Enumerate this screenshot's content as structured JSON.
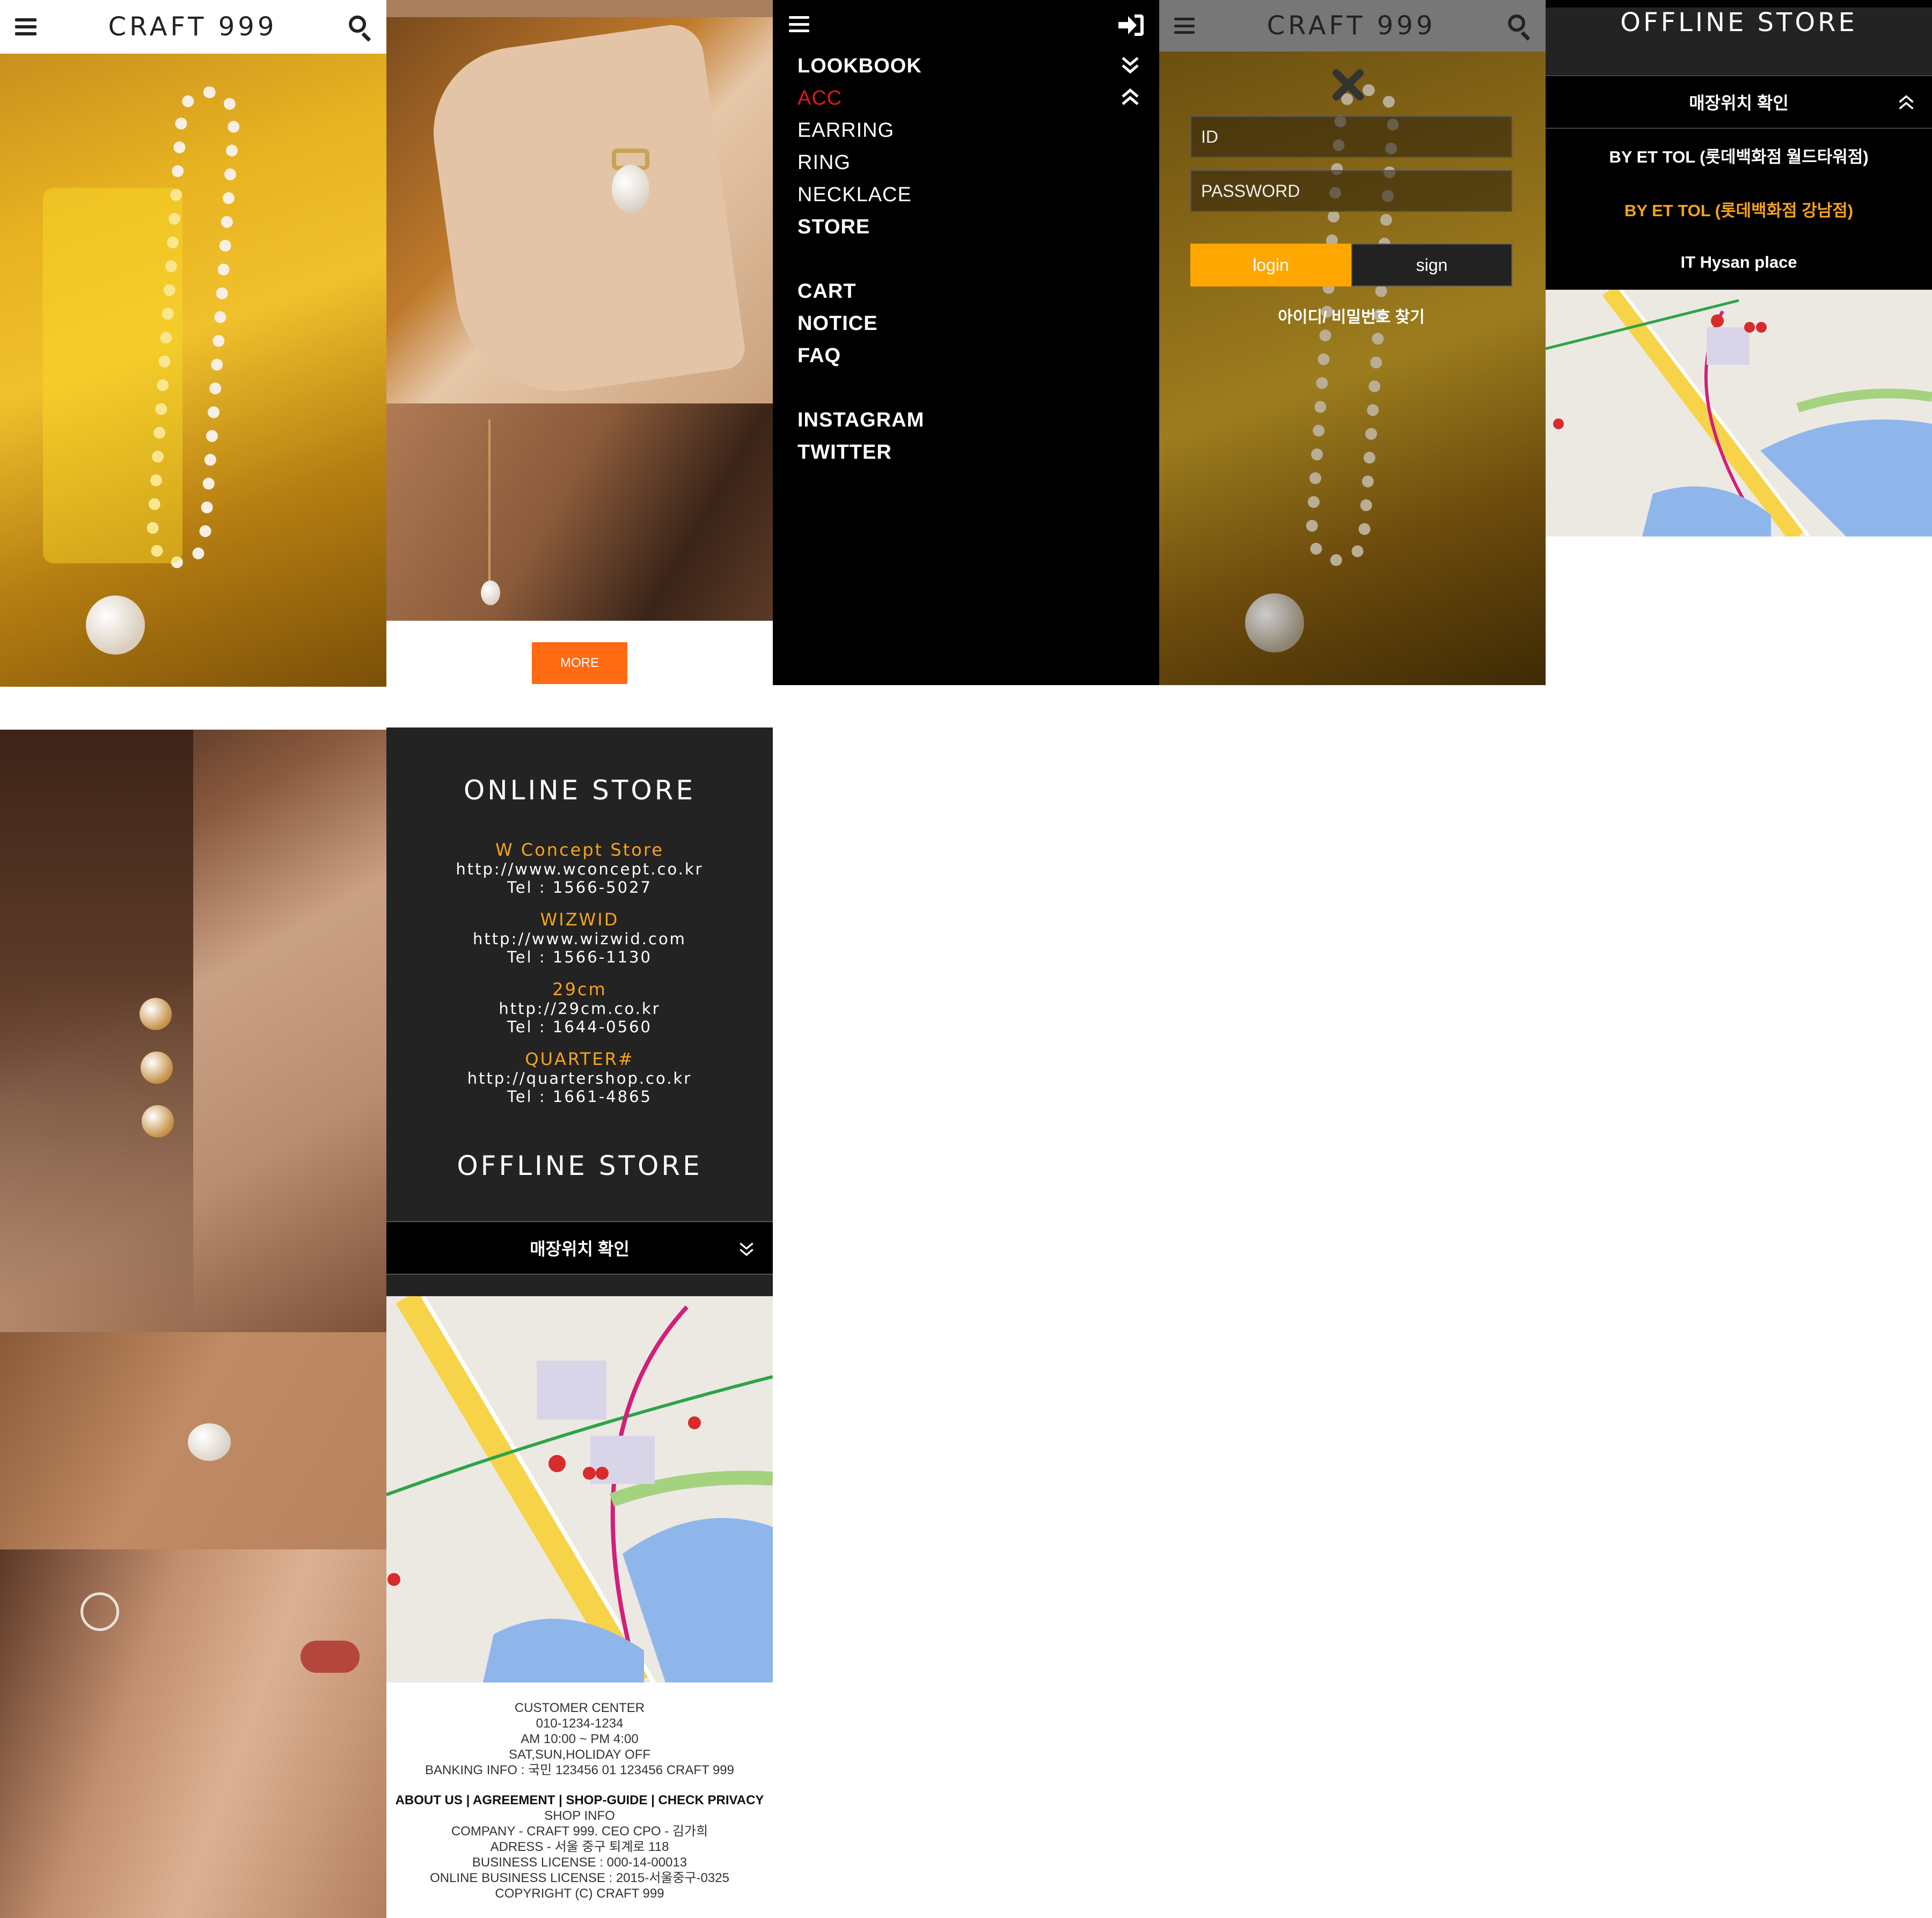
{
  "brand": "CRAFT 999",
  "header": {
    "menu_icon": "hamburger-icon",
    "search_icon": "search-icon"
  },
  "lookbook": {
    "more_label": "MORE"
  },
  "menu": {
    "items": [
      {
        "label": "LOOKBOOK",
        "style": "bold"
      },
      {
        "label": "ACC",
        "style": "active"
      },
      {
        "label": "EARRING",
        "style": "normal"
      },
      {
        "label": "RING",
        "style": "normal"
      },
      {
        "label": "NECKLACE",
        "style": "normal"
      },
      {
        "label": "STORE",
        "style": "bold"
      },
      {
        "label": "CART",
        "style": "bold"
      },
      {
        "label": "NOTICE",
        "style": "bold"
      },
      {
        "label": "FAQ",
        "style": "bold"
      },
      {
        "label": "INSTAGRAM",
        "style": "bold"
      },
      {
        "label": "TWITTER",
        "style": "bold"
      }
    ],
    "active_color": "#e0161f",
    "login_icon": "sign-in-icon"
  },
  "login": {
    "id_placeholder": "ID",
    "password_placeholder": "PASSWORD",
    "login_label": "login",
    "sign_label": "sign",
    "find_label": "아이디/ 비밀번호 찾기",
    "close_icon": "close-icon"
  },
  "offline_panel": {
    "title": "OFFLINE STORE",
    "toggle_label": "매장위치 확인",
    "stores": [
      {
        "name": "BY ET TOL (롯데백화점 월드타워점)",
        "highlight": false
      },
      {
        "name": "BY ET TOL (롯데백화점 강남점)",
        "highlight": true
      },
      {
        "name": "IT Hysan place",
        "highlight": false
      }
    ]
  },
  "online_store": {
    "title": "ONLINE STORE",
    "stores": [
      {
        "name": "W Concept Store",
        "url": "http://www.wconcept.co.kr",
        "tel": "Tel : 1566-5027"
      },
      {
        "name": "WIZWID",
        "url": "http://www.wizwid.com",
        "tel": "Tel : 1566-1130"
      },
      {
        "name": "29cm",
        "url": "http://29cm.co.kr",
        "tel": "Tel : 1644-0560"
      },
      {
        "name": "QUARTER#",
        "url": "http://quartershop.co.kr",
        "tel": "Tel : 1661-4865"
      }
    ],
    "offline_title": "OFFLINE STORE",
    "toggle_label": "매장위치 확인"
  },
  "footer": {
    "customer": [
      "CUSTOMER CENTER",
      "010-1234-1234",
      "AM 10:00 ~ PM 4:00",
      "SAT,SUN,HOLIDAY OFF",
      "BANKING INFO : 국민 123456 01 123456 CRAFT 999"
    ],
    "links": "ABOUT US | AGREEMENT | SHOP-GUIDE | CHECK PRIVACY",
    "shop": [
      "SHOP INFO",
      "COMPANY - CRAFT 999. CEO CPO - 김가희",
      "ADRESS - 서울 중구 퇴계로 118",
      "BUSINESS LICENSE : 000-14-00013",
      "ONLINE BUSINESS LICENSE : 2015-서울중구-0325",
      "COPYRIGHT (C) CRAFT 999"
    ]
  },
  "colors": {
    "accent_orange": "#ff6a13",
    "login_yellow": "#ffa600",
    "store_gold": "#f5a31a",
    "panel_dark": "#232323"
  }
}
